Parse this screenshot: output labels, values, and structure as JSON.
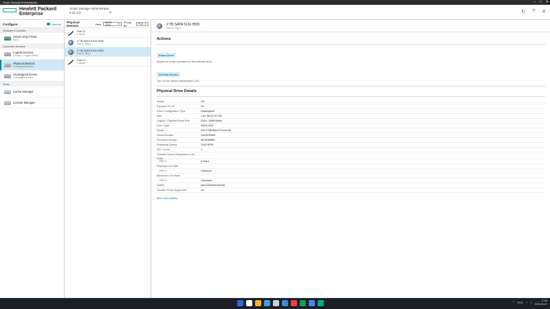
{
  "window": {
    "title": "Smart Storage Administrator",
    "controls": [
      "–",
      "□",
      "✕"
    ]
  },
  "header": {
    "brand_line1": "Hewlett Packard",
    "brand_line2": "Enterprise",
    "app_name": "Smart Storage Administrator",
    "app_version": "6.21.2.0",
    "icons": [
      "refresh-icon",
      "help-icon",
      "close-icon"
    ]
  },
  "left": {
    "title": "Configure",
    "refresh_label": "Refresh",
    "section_selected": "Selected Controller",
    "controller": {
      "name": "Smart Array P420i",
      "sub": "Slot 0"
    },
    "section_devices": "Controller Devices",
    "devices": [
      {
        "name": "Logical Devices",
        "sub": "0 Arrays, 0 Logical Drives"
      },
      {
        "name": "Physical Devices",
        "sub": "4 Unassigned Drives"
      },
      {
        "name": "Unassigned Drives",
        "sub": "2 Unassigned Drives"
      }
    ],
    "section_tools": "Tools",
    "tools": [
      {
        "name": "Cache Manager"
      },
      {
        "name": "License Manager"
      }
    ]
  },
  "middle": {
    "title": "Physical Devices",
    "view_label": "View",
    "view_value": "SATA HDD",
    "group_label": "Group By",
    "group_value": "Port",
    "items": [
      {
        "name": "Port 1I",
        "sub": "1 device"
      },
      {
        "name": "2 TB SATA 512e HDD",
        "sub": "Port 1I : Bay 6"
      },
      {
        "name": "2 TB SATA 512e HDD",
        "sub": "Port 1I : Bay 7"
      },
      {
        "name": "Port 2I",
        "sub": "1 device"
      }
    ]
  },
  "right": {
    "title": "2 TB SATA 512e HDD",
    "subtitle": "Port 1I : Bay 7",
    "actions_heading": "Actions",
    "erase_label": "Erase Drive",
    "erase_desc": "Begins an erase operation on the selected drive.",
    "identify_label": "Identify Device",
    "identify_desc": "Turn on the device identification LED.",
    "details_heading": "Physical Drive Details",
    "details": [
      {
        "k": "Status",
        "v": "OK"
      },
      {
        "k": "Exposed To OS",
        "v": "No"
      },
      {
        "k": "Drive Configuration Type",
        "v": "Unassigned"
      },
      {
        "k": "Size",
        "v": "1.82 TiB (2.00 TB)"
      },
      {
        "k": "Logical / Physical Block Size",
        "v": "512e / 4096 Bytes"
      },
      {
        "k": "Drive Type",
        "v": "SATA HDD"
      },
      {
        "k": "Model",
        "v": "ATA TOSHIBA DT01ACA2"
      },
      {
        "k": "Serial Number",
        "v": "13A3DP8AS"
      },
      {
        "k": "Firmware Version",
        "v": "MX4OABB0"
      },
      {
        "k": "Rotational Speed",
        "v": "7200 RPM"
      },
      {
        "k": "PHY Count",
        "v": "1"
      },
      {
        "k": "Transfer Speed (Negotiated Link Rate)",
        "v": ""
      },
      {
        "k": "PHY 1",
        "v": "6 Gbps"
      },
      {
        "k": "Physical Link Rate",
        "v": ""
      },
      {
        "k": "PHY 1",
        "v": "Unknown"
      },
      {
        "k": "Maximum Link Rate",
        "v": ""
      },
      {
        "k": "PHY 1",
        "v": "Unknown"
      },
      {
        "k": "WWID",
        "v": "300143802521ED46"
      },
      {
        "k": "Sanitize Erase Supported",
        "v": "No"
      }
    ],
    "more_link": "More drive details"
  },
  "taskbar": {
    "time": "17:08",
    "date": "2025-06-27",
    "lang": "ENG",
    "colors": [
      "#2b6cd8",
      "#ffffff",
      "#f0b429",
      "#3fa0e6",
      "#c9d1d9",
      "#3d8bd4",
      "#ea4335",
      "#0f9d58",
      "#4285f4",
      "#01a982"
    ]
  }
}
